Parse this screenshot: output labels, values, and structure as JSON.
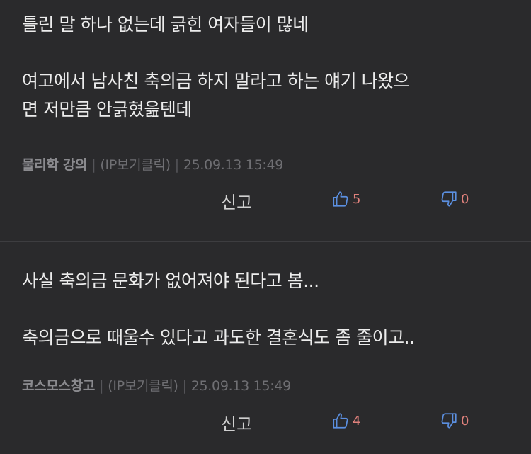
{
  "comments": [
    {
      "text": "틀린 말 하나 없는데 긁힌 여자들이 많네\n\n여고에서 남사친 축의금 하지 말라고 하는 얘기 나왔으\n면 저만큼 안긁혔읊텐데",
      "author": "물리학 강의",
      "ip_label": "(IP보기클릭)",
      "timestamp": "25.09.13 15:49",
      "report_label": "신고",
      "upvotes": "5",
      "downvotes": "0"
    },
    {
      "text": "사실 축의금 문화가 없어져야 된다고 봄...\n\n축의금으로 때울수 있다고 과도한 결혼식도 좀 줄이고..",
      "author": "코스모스창고",
      "ip_label": "(IP보기클릭)",
      "timestamp": "25.09.13 15:49",
      "report_label": "신고",
      "upvotes": "4",
      "downvotes": "0"
    }
  ],
  "meta_separator": "|",
  "colors": {
    "background": "#2a2a2c",
    "text": "#ececec",
    "meta": "#6f6f73",
    "vote_icon": "#5b8fe0",
    "vote_count": "#e0817c"
  },
  "icons": {
    "upvote": "thumbs-up-icon",
    "downvote": "thumbs-down-icon"
  }
}
